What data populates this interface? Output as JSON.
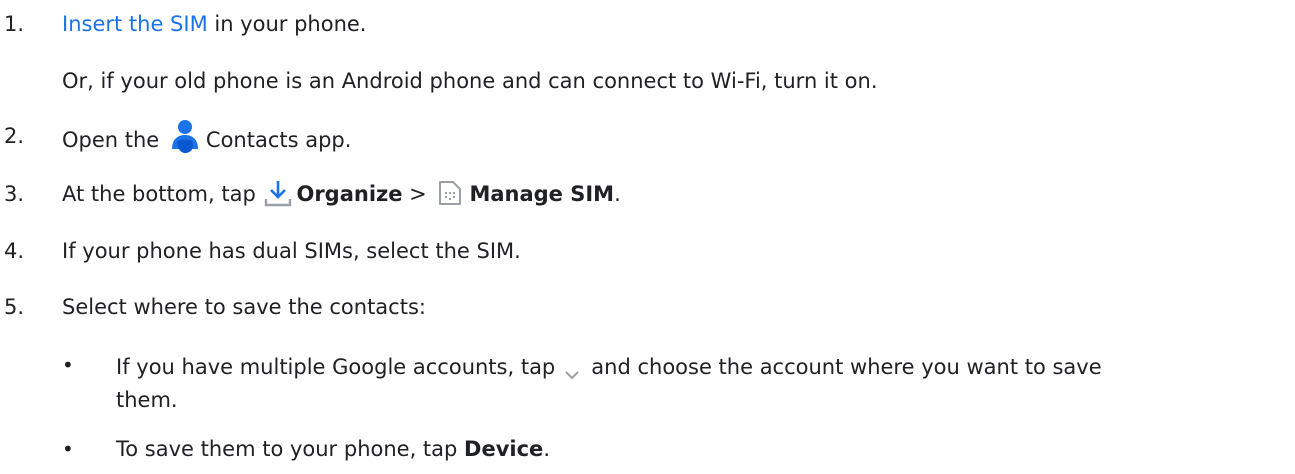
{
  "steps": [
    {
      "number": "1.",
      "link": "Insert the SIM",
      "text": " in your phone.",
      "note": "Or, if your old phone is an Android phone and can connect to Wi-Fi, turn it on."
    },
    {
      "number": "2.",
      "before": "Open the ",
      "icon": "contacts-person-icon",
      "after": "Contacts app."
    },
    {
      "number": "3.",
      "before": "At the bottom, tap ",
      "organize_label": "Organize",
      "separator": " > ",
      "manage_label": "Manage SIM",
      "end": "."
    },
    {
      "number": "4.",
      "text": "If your phone has dual SIMs, select the SIM."
    },
    {
      "number": "5.",
      "text": "Select where to save the contacts:"
    }
  ],
  "bullets": [
    {
      "before": "If you have multiple Google accounts, tap",
      "after": "and choose the account where you want to save",
      "wrap": "them."
    },
    {
      "before": "To save them to your phone, tap ",
      "bold": "Device",
      "end": "."
    }
  ],
  "bullet_char": "•",
  "colors": {
    "text": "#202124",
    "link": "#1a73e8",
    "icon_blue": "#1a73e8",
    "icon_gray": "#9aa0a6"
  }
}
